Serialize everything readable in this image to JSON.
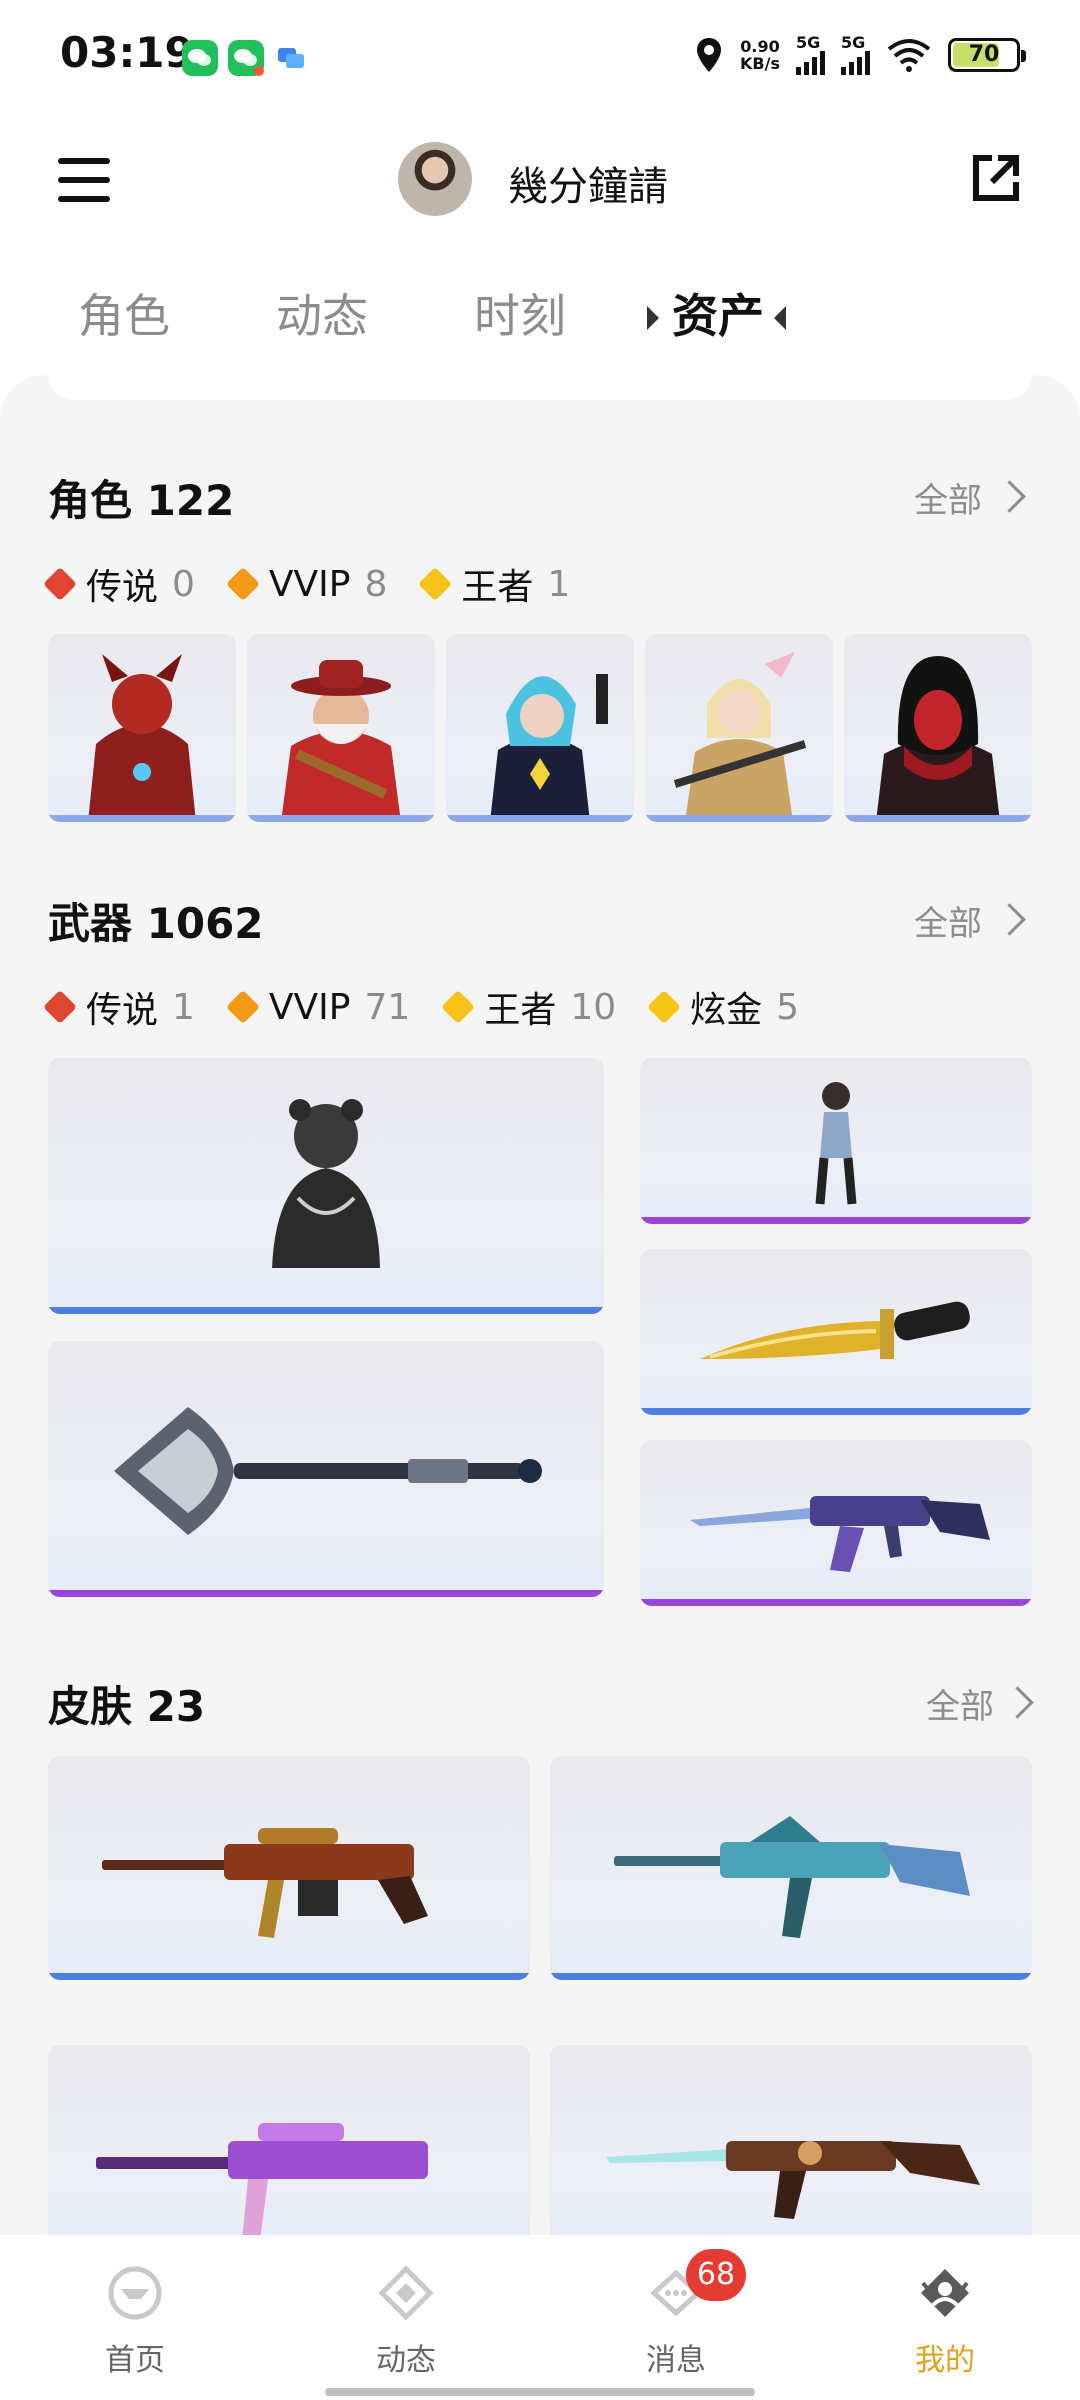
{
  "status_bar": {
    "time": "03:19",
    "net_speed_value": "0.90",
    "net_speed_unit": "KB/s",
    "sig1_label": "5G",
    "sig2_label": "5G",
    "battery": "70",
    "icons": [
      "wechat-icon",
      "wechat-icon",
      "message-app-icon",
      "location-icon",
      "wifi-icon",
      "battery-icon"
    ]
  },
  "header": {
    "username": "幾分鐘請",
    "menu_icon": "menu-icon",
    "share_icon": "external-link-icon"
  },
  "tabs": [
    {
      "label": "角色"
    },
    {
      "label": "动态"
    },
    {
      "label": "时刻"
    },
    {
      "label": "资产"
    }
  ],
  "active_tab": 3,
  "sections": {
    "characters": {
      "title": "角色 122",
      "more": "全部",
      "badges": [
        {
          "name": "传说",
          "count": "0",
          "color": "#e2452f"
        },
        {
          "name": "VVIP",
          "count": "8",
          "color": "#f29a16"
        },
        {
          "name": "王者",
          "count": "1",
          "color": "#f7c21a"
        }
      ],
      "items": [
        {
          "name": "red-armored-character"
        },
        {
          "name": "cowboy-santa-character"
        },
        {
          "name": "blue-hair-female-character"
        },
        {
          "name": "blonde-female-character"
        },
        {
          "name": "hooded-red-character"
        }
      ]
    },
    "weapons": {
      "title": "武器 1062",
      "more": "全部",
      "badges": [
        {
          "name": "传说",
          "count": "1",
          "color": "#e2452f"
        },
        {
          "name": "VVIP",
          "count": "71",
          "color": "#f29a16"
        },
        {
          "name": "王者",
          "count": "10",
          "color": "#f7c21a"
        },
        {
          "name": "炫金",
          "count": "5",
          "color": "#f5c518"
        }
      ],
      "items": [
        {
          "name": "bear-mascot-item",
          "rarity_color": "#4d7ee0"
        },
        {
          "name": "female-agent-figure",
          "rarity_color": "#9a45d8"
        },
        {
          "name": "ornate-shovel",
          "rarity_color": "#9a45d8"
        },
        {
          "name": "golden-knife",
          "rarity_color": "#4d7ee0"
        },
        {
          "name": "blue-purple-rifle",
          "rarity_color": "#9a45d8"
        }
      ]
    },
    "skins": {
      "title": "皮肤 23",
      "more": "全部",
      "items": [
        {
          "name": "gold-red-sniper-skin",
          "rarity_color": "#4d7ee0"
        },
        {
          "name": "cyan-dragon-rifle-skin",
          "rarity_color": "#4d7ee0"
        },
        {
          "name": "purple-sniper-skin",
          "rarity_color": "#9a45d8"
        },
        {
          "name": "copper-ak-skin",
          "rarity_color": "#9a45d8"
        }
      ]
    }
  },
  "bottom_nav": [
    {
      "label": "首页",
      "icon": "home-icon"
    },
    {
      "label": "动态",
      "icon": "feed-icon"
    },
    {
      "label": "消息",
      "icon": "message-icon",
      "badge": "68"
    },
    {
      "label": "我的",
      "icon": "profile-icon"
    }
  ],
  "active_nav": 3,
  "colors": {
    "accent": "#e0a11b",
    "badge_red": "#e63b32",
    "background": "#f5f5f5"
  }
}
